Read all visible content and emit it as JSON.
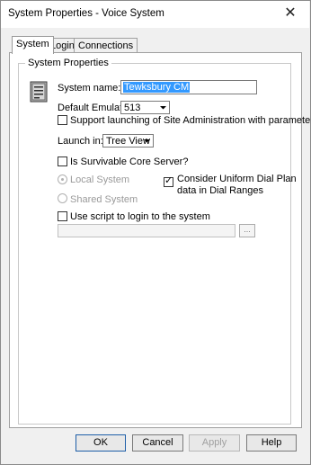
{
  "window": {
    "title": "System Properties - Voice System"
  },
  "tabs": [
    {
      "label": "System",
      "active": true
    },
    {
      "label": "Login",
      "active": false
    },
    {
      "label": "Connections",
      "active": false
    }
  ],
  "group": {
    "title": "System Properties"
  },
  "system_name": {
    "label": "System name:",
    "value": "Tewksbury CM"
  },
  "default_emulator": {
    "label": "Default Emulator:",
    "value": "513"
  },
  "support_launch": {
    "label": "Support launching of Site Administration with parameters",
    "checked": false
  },
  "launch_in": {
    "label": "Launch in:",
    "value": "Tree View"
  },
  "survivable": {
    "label": "Is Survivable Core Server?",
    "checked": false
  },
  "local_system": {
    "label": "Local System",
    "selected": true,
    "enabled": false
  },
  "shared_system": {
    "label": "Shared System",
    "selected": false,
    "enabled": false
  },
  "uniform_dial_plan": {
    "label_line1": "Consider Uniform Dial Plan",
    "label_line2": "data in Dial Ranges",
    "checked": true
  },
  "use_script": {
    "label": "Use script to login to the system",
    "checked": false,
    "path_value": "",
    "browse_label": "..."
  },
  "buttons": {
    "ok": "OK",
    "cancel": "Cancel",
    "apply": "Apply",
    "help": "Help"
  },
  "colors": {
    "selection": "#3399ff",
    "dialog_bg": "#f0f0f0",
    "panel_bg": "#ffffff",
    "disabled_text": "#9a9a9a"
  }
}
